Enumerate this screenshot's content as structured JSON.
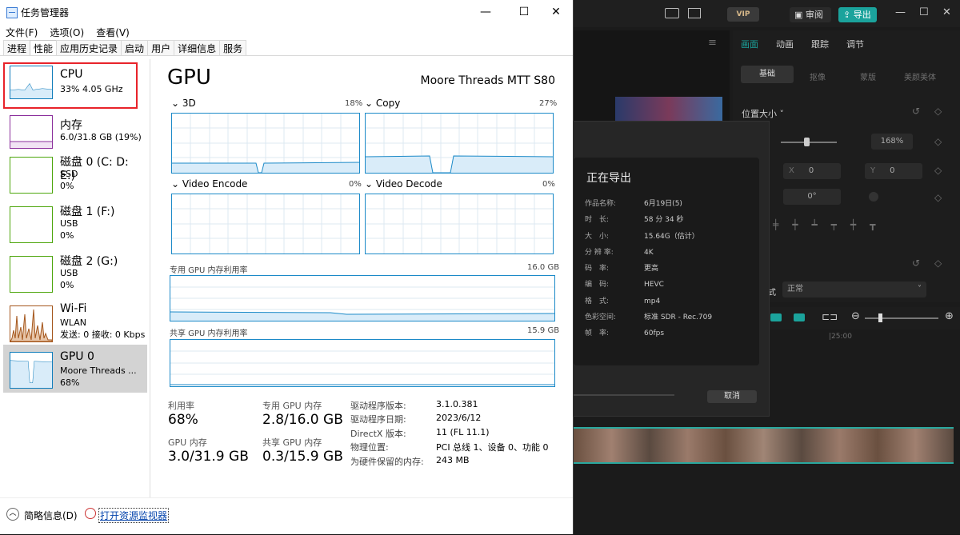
{
  "window": {
    "title": "任务管理器",
    "controls": {
      "minimize": "—",
      "maximize": "☐",
      "close": "✕"
    }
  },
  "menu": [
    "文件(F)",
    "选项(O)",
    "查看(V)"
  ],
  "tabs": [
    "进程",
    "性能",
    "应用历史记录",
    "启动",
    "用户",
    "详细信息",
    "服务"
  ],
  "sidebar": [
    {
      "name": "CPU",
      "line1": "33%  4.05 GHz",
      "line2": "",
      "line3": ""
    },
    {
      "name": "内存",
      "line1": "6.0/31.8 GB (19%)",
      "line2": "",
      "line3": ""
    },
    {
      "name": "磁盘 0 (C: D: E:)",
      "line1": "SSD",
      "line2": "0%",
      "line3": ""
    },
    {
      "name": "磁盘 1 (F:)",
      "line1": "USB",
      "line2": "0%",
      "line3": ""
    },
    {
      "name": "磁盘 2 (G:)",
      "line1": "USB",
      "line2": "0%",
      "line3": ""
    },
    {
      "name": "Wi-Fi",
      "line1": "WLAN",
      "line2": "发送: 0  接收: 0 Kbps",
      "line3": ""
    },
    {
      "name": "GPU 0",
      "line1": "Moore Threads ...",
      "line2": "68%",
      "line3": ""
    }
  ],
  "gpu": {
    "title": "GPU",
    "model": "Moore Threads MTT S80",
    "engines": [
      {
        "name": "3D",
        "pct": "18%"
      },
      {
        "name": "Copy",
        "pct": "27%"
      },
      {
        "name": "Video Encode",
        "pct": "0%"
      },
      {
        "name": "Video Decode",
        "pct": "0%"
      }
    ],
    "dedicated_label": "专用 GPU 内存利用率",
    "dedicated_max": "16.0 GB",
    "shared_label": "共享 GPU 内存利用率",
    "shared_max": "15.9 GB",
    "stats": [
      {
        "label": "利用率",
        "value": "68%"
      },
      {
        "label": "专用 GPU 内存",
        "value": "2.8/16.0 GB"
      },
      {
        "label": "GPU 内存",
        "value": "3.0/31.9 GB"
      },
      {
        "label": "共享 GPU 内存",
        "value": "0.3/15.9 GB"
      }
    ],
    "info": [
      {
        "k": "驱动程序版本:",
        "v": "3.1.0.381"
      },
      {
        "k": "驱动程序日期:",
        "v": "2023/6/12"
      },
      {
        "k": "DirectX 版本:",
        "v": "11 (FL 11.1)"
      },
      {
        "k": "物理位置:",
        "v": "PCI 总线 1、设备 0、功能 0"
      },
      {
        "k": "为硬件保留的内存:",
        "v": "243 MB"
      }
    ]
  },
  "footer": {
    "less": "简略信息(D)",
    "monitor": "打开资源监视器"
  },
  "editor": {
    "vip": "VIP",
    "review": "审阅",
    "export": "导出",
    "tabs": [
      "画面",
      "动画",
      "跟踪",
      "调节"
    ],
    "subtabs": [
      "基础",
      "抠像",
      "蒙版",
      "美颜美体"
    ],
    "position": "位置大小",
    "scale": "168%",
    "x_label": "X",
    "x_val": "0",
    "y_label": "Y",
    "y_val": "0",
    "rotate": "0°",
    "blend_label": "式",
    "blend": "正常",
    "timeline_time": "|25:00",
    "export_dialog": {
      "title": "正在导出",
      "rows": [
        {
          "k": "作品名称:",
          "v": "6月19日(5)"
        },
        {
          "k": "时　长:",
          "v": "58 分 34 秒"
        },
        {
          "k": "大　小:",
          "v": "15.64G（估计）"
        },
        {
          "k": "分 辨 率:",
          "v": "4K"
        },
        {
          "k": "码　率:",
          "v": "更高"
        },
        {
          "k": "编　码:",
          "v": "HEVC"
        },
        {
          "k": "格　式:",
          "v": "mp4"
        },
        {
          "k": "色彩空间:",
          "v": "标准 SDR - Rec.709"
        },
        {
          "k": "帧　率:",
          "v": "60fps"
        }
      ],
      "cancel": "取消"
    }
  },
  "colors": {
    "highlight_box": "#e8232a",
    "graph_line": "#1c8ac8",
    "mem_purple": "#8b2f9c",
    "disk_green": "#4da60c",
    "wifi_brown": "#a4561c",
    "accent_teal": "#1ba39c"
  }
}
